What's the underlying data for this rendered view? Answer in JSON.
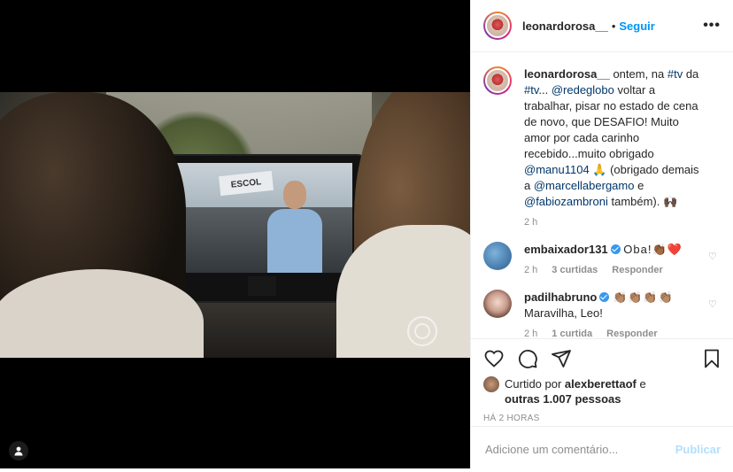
{
  "header": {
    "username": "leonardorosa__",
    "separator": "•",
    "follow_label": "Seguir",
    "more_label": "•••"
  },
  "media": {
    "tv_sign_text": "ESCOL",
    "watermark_icon": "globo-logo-icon",
    "user_tag_icon": "user-icon"
  },
  "caption": {
    "username": "leonardorosa__",
    "t1": " ontem, na ",
    "l1": "#tv",
    "t2": " da ",
    "l2": "#tv",
    "t3": "... ",
    "l3": "@redeglobo",
    "t4": " voltar a trabalhar, pisar no estado de cena de novo, que DESAFIO! Muito amor por cada carinho recebido...muito obrigado ",
    "l4": "@manu1104",
    "t5": " 🙏 (obrigado demais a ",
    "l5": "@marcellabergamo",
    "t6": " e ",
    "l6": "@fabiozambroni",
    "t7": " também). 🙌🏿",
    "time": "2 h"
  },
  "comments": [
    {
      "username": "embaixador131",
      "text": "Oba!👏🏾❤️",
      "time": "2 h",
      "likes": "3 curtidas",
      "reply": "Responder"
    },
    {
      "username": "padilhabruno",
      "emojis": "👏🏽👏🏽👏🏽👏🏽",
      "text": "Maravilha, Leo!",
      "time": "2 h",
      "likes": "1 curtida",
      "reply": "Responder"
    }
  ],
  "likes": {
    "prefix": "Curtido por ",
    "user": "alexberettaof",
    "middle": " e",
    "others": "outras 1.007 pessoas"
  },
  "timestamp": "HÁ 2 HORAS",
  "add_comment": {
    "placeholder": "Adicione um comentário...",
    "publish_label": "Publicar"
  },
  "colors": {
    "accent": "#0095f6",
    "link": "#00376b",
    "muted": "#8e8e8e",
    "publish_disabled": "#b2dffc"
  }
}
